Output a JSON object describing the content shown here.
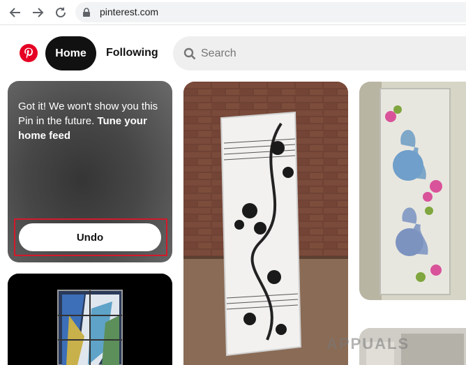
{
  "browser": {
    "url": "pinterest.com",
    "icons": [
      "back-arrow-icon",
      "forward-arrow-icon",
      "reload-icon",
      "lock-icon"
    ]
  },
  "header": {
    "home_label": "Home",
    "following_label": "Following",
    "search_placeholder": "Search"
  },
  "hidden_pin": {
    "message": "Got it! We won't show you this Pin in the future.",
    "link_text": "Tune your home feed",
    "undo_label": "Undo"
  },
  "pins": [
    {
      "name": "glass-door-pin",
      "description": "frosted glass door with black floral pattern leaning on brick wall"
    },
    {
      "name": "swan-glass-pin",
      "description": "etched glass panel with painted swans and flowers"
    },
    {
      "name": "stained-glass-pin",
      "description": "stained glass window on black background"
    },
    {
      "name": "partial-pin",
      "description": "partially visible pin"
    }
  ],
  "watermark_text": "APPUALS",
  "colors": {
    "pinterest_red": "#e60023",
    "highlight_red": "#d3192a",
    "home_pill": "#111111"
  }
}
